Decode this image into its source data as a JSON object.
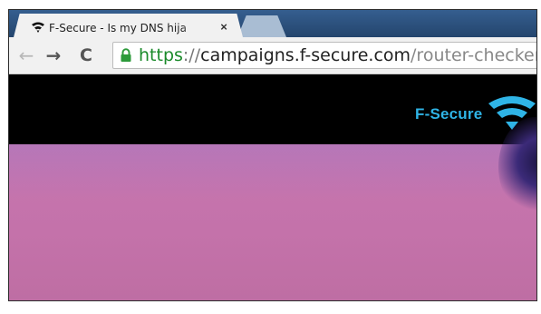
{
  "browser": {
    "tabs": [
      {
        "title": "F-Secure - Is my DNS hija",
        "icon": "fsecure-favicon-icon",
        "active": true
      },
      {
        "title": "",
        "active": false
      }
    ],
    "tab_close_label": "×",
    "toolbar": {
      "back_label": "←",
      "forward_label": "→",
      "reload_label": "C"
    },
    "address_bar": {
      "scheme": "https",
      "separator": "://",
      "host": "campaigns.f-secure.com",
      "path": "/router-checker/",
      "secure": true
    }
  },
  "page": {
    "brand_name": "F-Secure",
    "colors": {
      "brand": "#2fb4e6",
      "header_bg": "#000000",
      "hero_bg": "#c472aa",
      "secure_green": "#1a8a2a"
    }
  }
}
